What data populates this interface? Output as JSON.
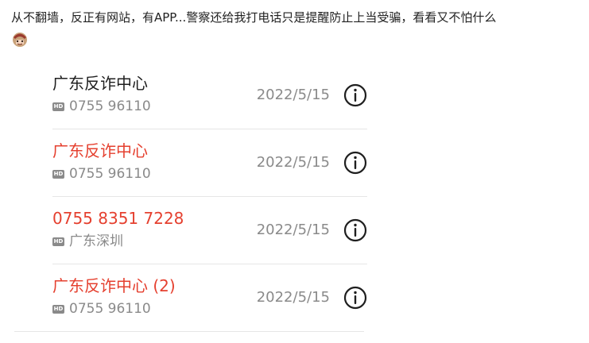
{
  "post": {
    "text": "从不翻墙，反正有网站，有APP...警察还给我打电话只是提醒防止上当受骗，看看又不怕什么",
    "emoji": "emoji-face"
  },
  "call_log": {
    "hd_badge": "HD",
    "calls": [
      {
        "name": "广东反诈中心",
        "subtitle": "0755 96110",
        "date": "2022/5/15",
        "missed": false
      },
      {
        "name": "广东反诈中心",
        "subtitle": "0755 96110",
        "date": "2022/5/15",
        "missed": true
      },
      {
        "name": "0755 8351 7228",
        "subtitle": "广东深圳",
        "date": "2022/5/15",
        "missed": true
      },
      {
        "name": "广东反诈中心 (2)",
        "subtitle": "0755 96110",
        "date": "2022/5/15",
        "missed": true
      }
    ],
    "colors": {
      "missed": "#e5402f",
      "normal": "#1f1f1f",
      "secondary": "#8a8a8a"
    },
    "icon": "info-icon"
  }
}
